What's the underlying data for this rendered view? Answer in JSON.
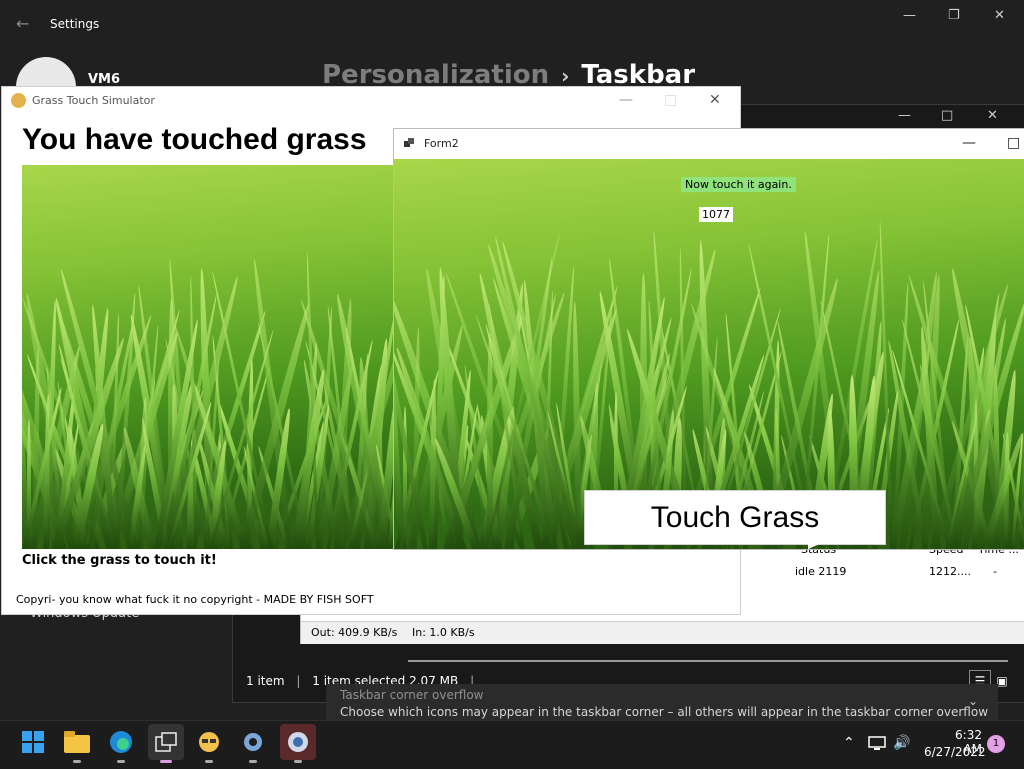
{
  "settings": {
    "title": "Settings",
    "user": "VM6",
    "breadcrumb_parent": "Personalization",
    "breadcrumb_current": "Taskbar",
    "windows_update": "Windows Update",
    "overflow_title": "Taskbar corner overflow",
    "overflow_desc": "Choose which icons may appear in the taskbar corner – all others will appear in the taskbar corner overflow menu"
  },
  "explorer": {
    "status_items": "1 item",
    "status_selected": "1 item selected  2.07 MB"
  },
  "network": {
    "col_status": "Status",
    "col_speed": "Speed",
    "col_time": "Time ...",
    "row_status": "idle 2119",
    "row_speed": "1212....",
    "row_time": "-",
    "out": "Out: 409.9 KB/s",
    "in": "In: 1.0 KB/s"
  },
  "gts": {
    "title": "Grass Touch Simulator",
    "heading": "You have touched grass",
    "click_label": "Click the grass to touch it!",
    "copyright": "Copyri- you know what fuck it no copyright - MADE BY FISH SOFT"
  },
  "form2": {
    "title": "Form2",
    "prompt": "Now touch it again.",
    "counter": "1077",
    "button_label": "Touch Grass"
  },
  "taskbar": {
    "time": "6:32 AM",
    "date": "6/27/2022",
    "notification_count": "1"
  }
}
